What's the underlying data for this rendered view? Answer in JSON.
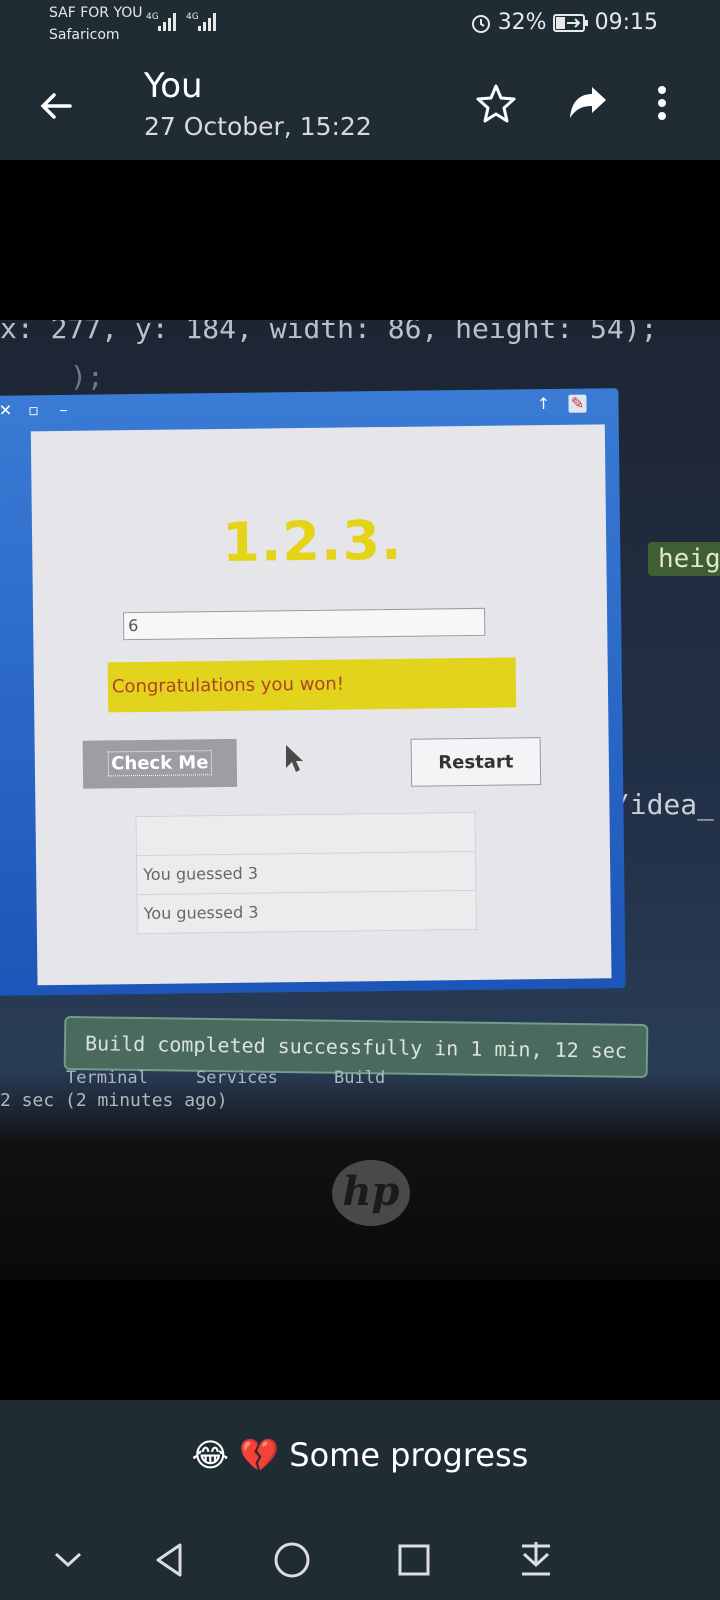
{
  "status_bar": {
    "carrier_line1": "SAF FOR YOU",
    "carrier_line2": "Safaricom",
    "net1": "4G",
    "net2": "4G",
    "battery": "32%",
    "time": "09:15"
  },
  "header": {
    "sender": "You",
    "date": "27 October, 15:22"
  },
  "photo": {
    "code_top": "x: 277,  y: 184,  width: 86,  height: 54);",
    "code_tag": "heig",
    "code_path": "b/idea_",
    "app": {
      "title": "1.2.3.",
      "input_value": "6",
      "message": "Congratulations you won!",
      "check_label": "Check Me",
      "restart_label": "Restart",
      "list": [
        "",
        "You guessed 3",
        "You guessed 3"
      ]
    },
    "build_message": "Build completed successfully in 1 min, 12 sec",
    "toolbar": [
      "Terminal",
      "Services",
      "Build"
    ],
    "status_line": "2 sec (2 minutes ago)",
    "laptop_logo": "hp"
  },
  "caption": "😂 💔 Some progress",
  "colors": {
    "bar": "#1f2c34",
    "accent_yellow": "#e2d31c"
  }
}
